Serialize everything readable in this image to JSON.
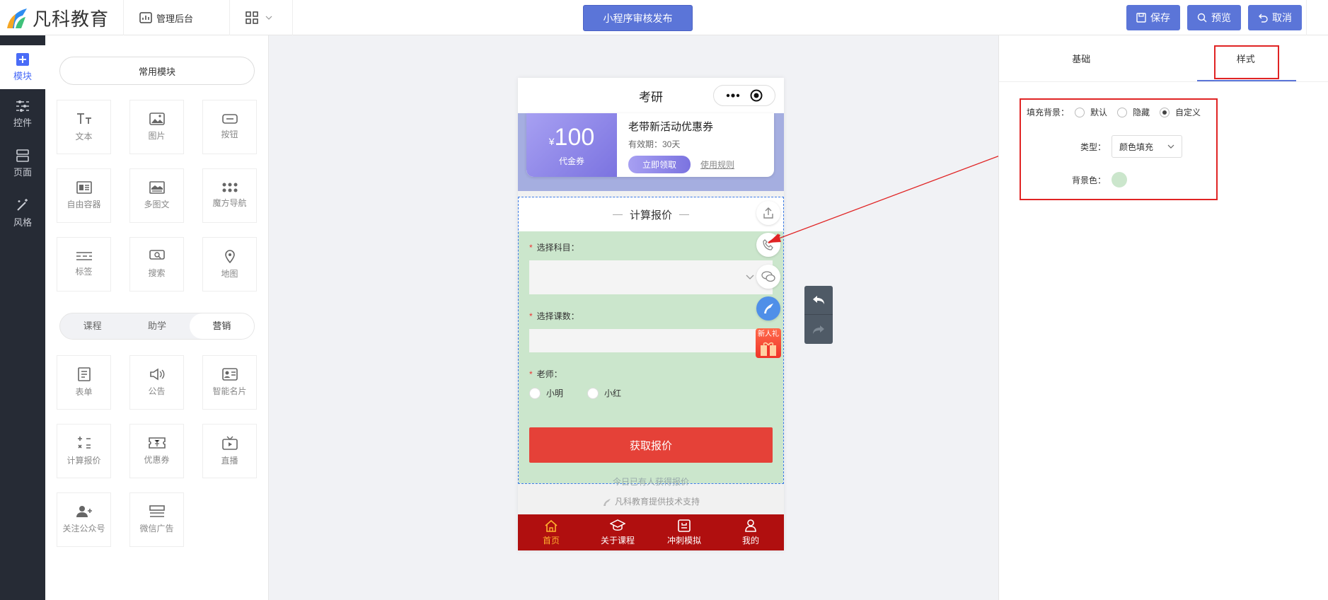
{
  "header": {
    "logo_text": "凡科教育",
    "nav_admin": "管理后台",
    "publish_label": "小程序审核发布",
    "save_label": "保存",
    "preview_label": "预览",
    "cancel_label": "取消",
    "accent": "#5b75d8"
  },
  "sidebar": {
    "items": [
      {
        "label": "模块",
        "icon": "plus-square-icon"
      },
      {
        "label": "控件",
        "icon": "sliders-icon"
      },
      {
        "label": "页面",
        "icon": "layout-icon"
      },
      {
        "label": "风格",
        "icon": "magic-wand-icon"
      }
    ]
  },
  "modules": {
    "common_title": "常用模块",
    "common": [
      {
        "label": "文本",
        "icon": "text-icon"
      },
      {
        "label": "图片",
        "icon": "image-icon"
      },
      {
        "label": "按钮",
        "icon": "button-icon"
      },
      {
        "label": "自由容器",
        "icon": "container-icon"
      },
      {
        "label": "多图文",
        "icon": "multi-image-icon"
      },
      {
        "label": "魔方导航",
        "icon": "grid-dots-icon"
      },
      {
        "label": "标签",
        "icon": "tag-icon"
      },
      {
        "label": "搜索",
        "icon": "search-icon"
      },
      {
        "label": "地图",
        "icon": "map-pin-icon"
      }
    ],
    "tabs": [
      "课程",
      "助学",
      "营销"
    ],
    "active_tab": "营销",
    "marketing": [
      {
        "label": "表单",
        "icon": "form-icon"
      },
      {
        "label": "公告",
        "icon": "speaker-icon"
      },
      {
        "label": "智能名片",
        "icon": "card-icon"
      },
      {
        "label": "计算报价",
        "icon": "calculator-icon"
      },
      {
        "label": "优惠券",
        "icon": "coupon-icon"
      },
      {
        "label": "直播",
        "icon": "tv-icon"
      },
      {
        "label": "关注公众号",
        "icon": "user-plus-icon"
      },
      {
        "label": "微信广告",
        "icon": "ad-icon"
      }
    ]
  },
  "phone": {
    "title": "考研",
    "coupon": {
      "currency": "¥",
      "amount": "100",
      "type": "代金券",
      "title": "老带新活动优惠券",
      "validity": "有效期：30天",
      "claim": "立即领取",
      "rules": "使用规则"
    },
    "calc": {
      "title": "计算报价",
      "subject_label": "选择科目：",
      "lessons_label": "选择课数：",
      "teacher_label": "老师：",
      "teacher_options": [
        "小明",
        "小红"
      ],
      "submit": "获取报价",
      "note": "今日已有人获得报价",
      "bg_color": "#cbe6cc"
    },
    "gift_label": "新人礼",
    "support": "凡科教育提供技术支持",
    "tabbar": [
      {
        "label": "首页",
        "icon": "home-icon"
      },
      {
        "label": "关于课程",
        "icon": "graduation-cap-icon"
      },
      {
        "label": "冲刺模拟",
        "icon": "exam-icon"
      },
      {
        "label": "我的",
        "icon": "user-icon"
      }
    ]
  },
  "right_panel": {
    "tabs": [
      "基础",
      "样式"
    ],
    "active_tab": "样式",
    "fill_label": "填充背景：",
    "fill_options": [
      "默认",
      "隐藏",
      "自定义"
    ],
    "fill_selected": "自定义",
    "type_label": "类型：",
    "type_value": "颜色填充",
    "bg_label": "背景色：",
    "bg_color": "#cbe6cc"
  }
}
